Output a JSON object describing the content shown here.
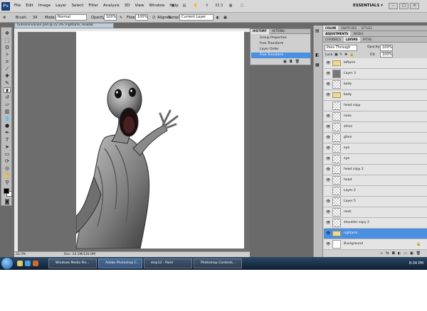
{
  "menubar": {
    "logo": "Ps",
    "items": [
      "File",
      "Edit",
      "Image",
      "Layer",
      "Select",
      "Filter",
      "Analysis",
      "3D",
      "View",
      "Window",
      "Help"
    ],
    "zoom": "33.3",
    "workspace": "ESSENTIALS ▾"
  },
  "options": {
    "brush_label": "Brush:",
    "brush_size": "34",
    "mode_label": "Mode:",
    "mode_value": "Normal",
    "opacity_label": "Opacity:",
    "opacity_value": "100%",
    "flow_label": "Flow:",
    "flow_value": "100%",
    "aligned_label": "Aligned",
    "sample_label": "Sample:",
    "sample_value": "Current Layer"
  },
  "document": {
    "tab_title": "humaninvasion.psd @ 22.3% (rightarm, RGB/8)",
    "zoom": "22.3%",
    "doc_size": "Doc: 24.1M/126.0M"
  },
  "history": {
    "tabs": [
      "HISTORY",
      "ACTIONS"
    ],
    "items": [
      "Group Properties",
      "Free Transform",
      "Layer Order",
      "Free Transform"
    ],
    "selected_index": 3
  },
  "panels": {
    "top_tabs": [
      "COLOR",
      "SWATCHES",
      "STYLES"
    ],
    "mid_tabs": [
      "ADJUSTMENTS",
      "MASKS"
    ],
    "layer_tabs": [
      "CHANNELS",
      "LAYERS",
      "PATHS"
    ],
    "blend_mode": "Pass Through",
    "opacity_label": "Opacity:",
    "opacity_value": "100%",
    "lock_label": "Lock:",
    "fill_label": "Fill:",
    "fill_value": "100%"
  },
  "layers": [
    {
      "name": "leftarm",
      "kind": "group",
      "visible": true
    },
    {
      "name": "Layer 3",
      "kind": "photo",
      "visible": true
    },
    {
      "name": "body",
      "kind": "layer",
      "visible": true
    },
    {
      "name": "body",
      "kind": "group",
      "visible": true
    },
    {
      "name": "head copy",
      "kind": "layer",
      "visible": false
    },
    {
      "name": "nose",
      "kind": "layer",
      "visible": true
    },
    {
      "name": "shine",
      "kind": "layer",
      "visible": true
    },
    {
      "name": "glare",
      "kind": "layer",
      "visible": true
    },
    {
      "name": "eye",
      "kind": "layer",
      "visible": true
    },
    {
      "name": "eye",
      "kind": "layer",
      "visible": true
    },
    {
      "name": "head copy 2",
      "kind": "layer",
      "visible": true
    },
    {
      "name": "head",
      "kind": "layer",
      "visible": true
    },
    {
      "name": "Layer 2",
      "kind": "layer",
      "visible": false
    },
    {
      "name": "Layer 5",
      "kind": "layer",
      "visible": true
    },
    {
      "name": "neck",
      "kind": "layer",
      "visible": true
    },
    {
      "name": "shoulder copy 2",
      "kind": "layer",
      "visible": true
    },
    {
      "name": "rightarm",
      "kind": "group",
      "visible": true,
      "selected": true
    },
    {
      "name": "Background",
      "kind": "background",
      "visible": true
    }
  ],
  "taskbar": {
    "items": [
      "Windows Media Pla...",
      "Adobe Photoshop C...",
      "step12 - Paint",
      "Photoshop Contests..."
    ],
    "active_index": 1,
    "clock": "8:34 PM"
  },
  "colors": {
    "accent": "#4a8fe0",
    "canvas": "#ffffff",
    "workspace": "#6d6d6d"
  }
}
